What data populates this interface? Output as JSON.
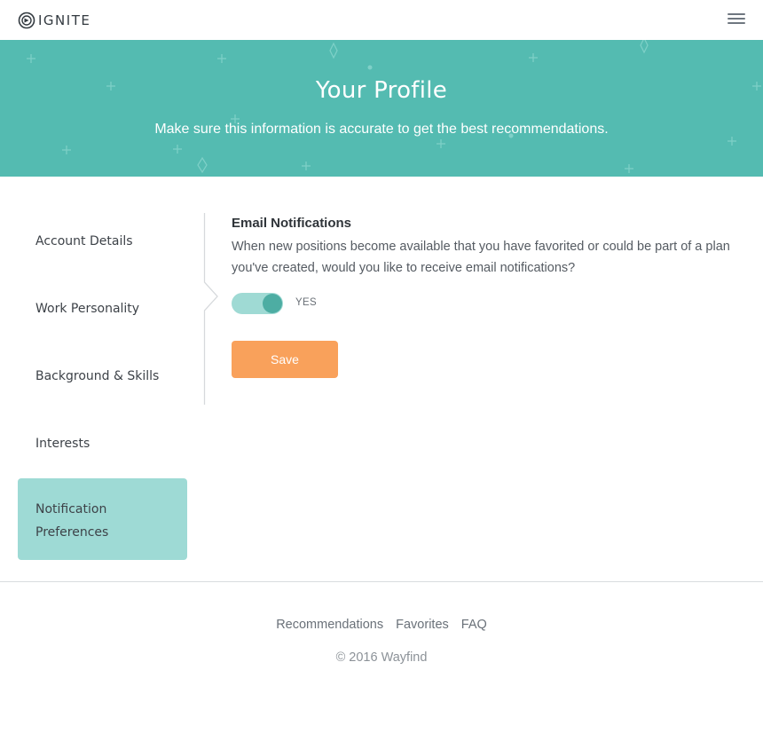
{
  "brand": {
    "name": "IGNITE"
  },
  "colors": {
    "hero": "#54bbb1",
    "active_nav": "#9edad5",
    "save": "#f9a15b",
    "toggle_track": "#9fdad4",
    "toggle_knob": "#4dada3"
  },
  "header": {
    "menu_icon": "hamburger-menu-icon"
  },
  "hero": {
    "title": "Your Profile",
    "subtitle": "Make sure this information is accurate to get the best recommendations."
  },
  "sidebar": {
    "items": [
      {
        "label": "Account Details",
        "active": false
      },
      {
        "label": "Work Personality",
        "active": false
      },
      {
        "label": "Background & Skills",
        "active": false
      },
      {
        "label": "Interests",
        "active": false
      },
      {
        "label": "Notification Preferences",
        "active": true
      }
    ]
  },
  "main": {
    "section_title": "Email Notifications",
    "description": "When new positions become available that you have favorited or could be part of a plan you've created, would you like to receive email notifications?",
    "toggle": {
      "on": true,
      "label": "YES"
    },
    "save_label": "Save"
  },
  "footer": {
    "links": [
      "Recommendations",
      "Favorites",
      "FAQ"
    ],
    "copyright": "© 2016 Wayfind"
  }
}
